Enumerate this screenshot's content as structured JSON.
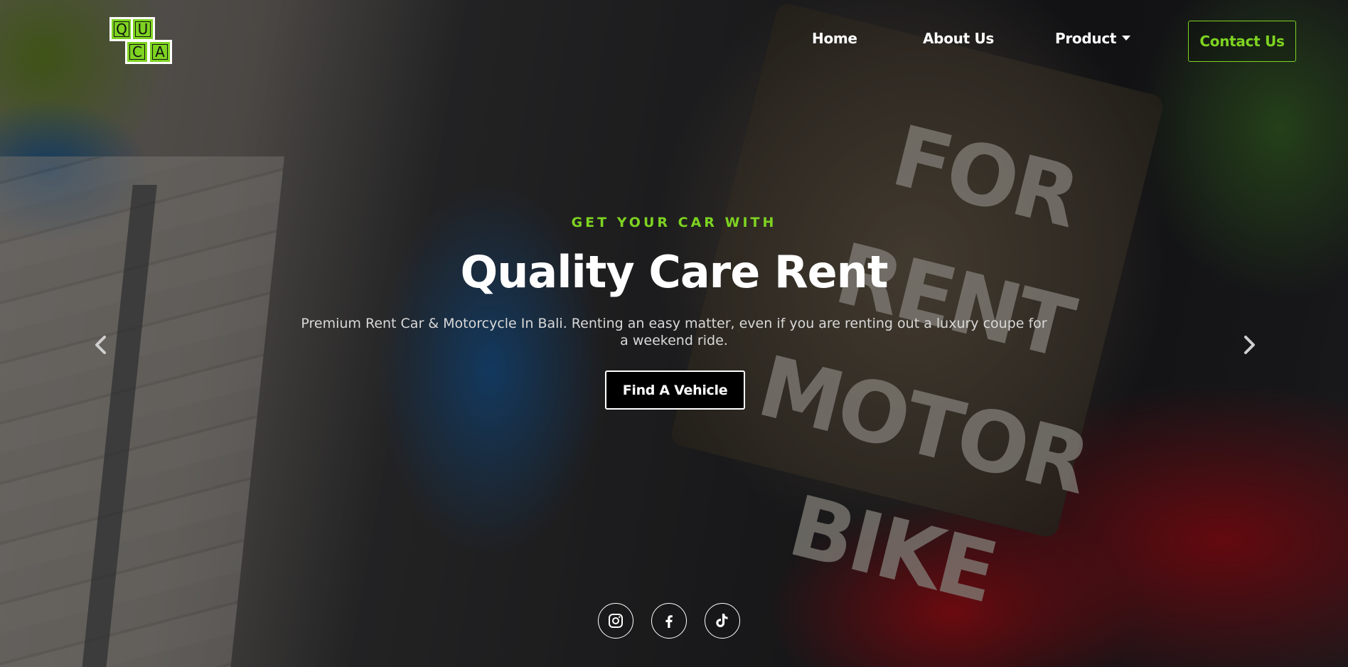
{
  "brand": {
    "logo_letters": [
      "Q",
      "U",
      "C",
      "A"
    ],
    "accent_color": "#7ed321"
  },
  "nav": {
    "items": [
      {
        "label": "Home"
      },
      {
        "label": "About Us"
      },
      {
        "label": "Product",
        "has_dropdown": true
      }
    ],
    "contact_label": "Contact Us"
  },
  "hero": {
    "background_sign_text": "FOR RENT MOTOR BIKE",
    "eyebrow": "GET YOUR CAR WITH",
    "title": "Quality Care Rent",
    "subtitle": "Premium Rent Car & Motorcycle In Bali. Renting an easy matter, even if you are renting out a luxury coupe for a weekend ride.",
    "cta_label": "Find A Vehicle",
    "prev_icon": "chevron-left-icon",
    "next_icon": "chevron-right-icon"
  },
  "socials": [
    {
      "name": "instagram-icon"
    },
    {
      "name": "facebook-icon"
    },
    {
      "name": "tiktok-icon"
    }
  ]
}
